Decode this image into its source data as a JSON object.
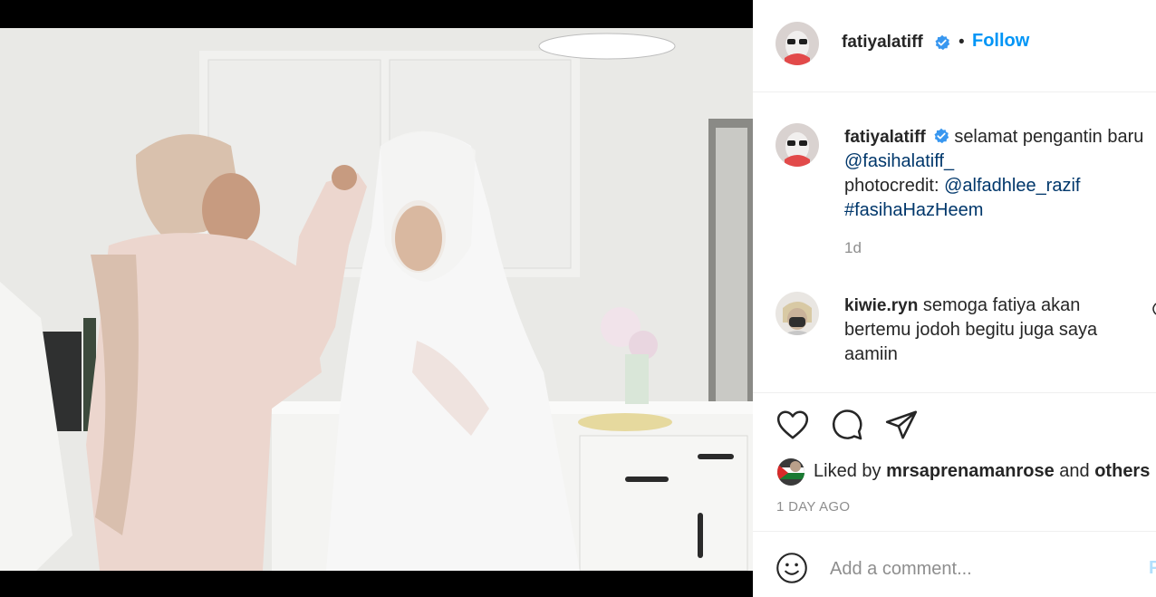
{
  "post": {
    "image_alt": "Wedding preparation photo: a woman in a pink hijab adjusting the veil of a bride in a white hijab in a white kitchen",
    "accent": "#0095f6"
  },
  "header": {
    "username": "fatiyalatiff",
    "verified_icon": "verified-badge-icon",
    "separator": "•",
    "follow_label": "Follow"
  },
  "caption": {
    "username": "fatiyalatiff",
    "text_line1": "selamat pengantin baru",
    "mention1": "@fasihalatiff_",
    "photocredit_label": "photocredit:",
    "mention2": "@alfadhlee_razif",
    "hashtag": "#fasihaHazHeem",
    "timestamp": "1d"
  },
  "comments": [
    {
      "username": "kiwie.ryn",
      "text": "semoga fatiya akan bertemu jodoh begitu juga saya aamiin"
    }
  ],
  "actions": {
    "like_icon": "heart-icon",
    "comment_icon": "comment-bubble-icon",
    "share_icon": "paper-plane-icon"
  },
  "likes": {
    "prefix": "Liked by",
    "user": "mrsaprenamanrose",
    "and": "and",
    "others": "others"
  },
  "post_age": "1 DAY AGO",
  "add_comment": {
    "placeholder": "Add a comment...",
    "emoji_icon": "smiley-icon",
    "post_label": "P"
  }
}
